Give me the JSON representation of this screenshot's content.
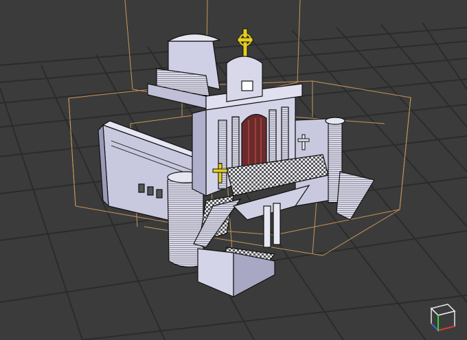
{
  "viewport": {
    "name": "3d-viewport",
    "background": "#3a3a3a",
    "grid_color": "#2a2a2a",
    "bbox_color": "#c89a5a",
    "model_fill": "#cfcfe6",
    "model_stroke": "#111111",
    "cross_color": "#e6cf1f"
  },
  "scene": {
    "model_name": "church-building-model",
    "view_mode": "wireframe-shaded",
    "selection_bounds": "visible"
  },
  "gizmo": {
    "icon": "view-cube-icon",
    "colors": {
      "x": "#d23a3a",
      "y": "#3ad23a",
      "z": "#3a6ad2"
    }
  }
}
